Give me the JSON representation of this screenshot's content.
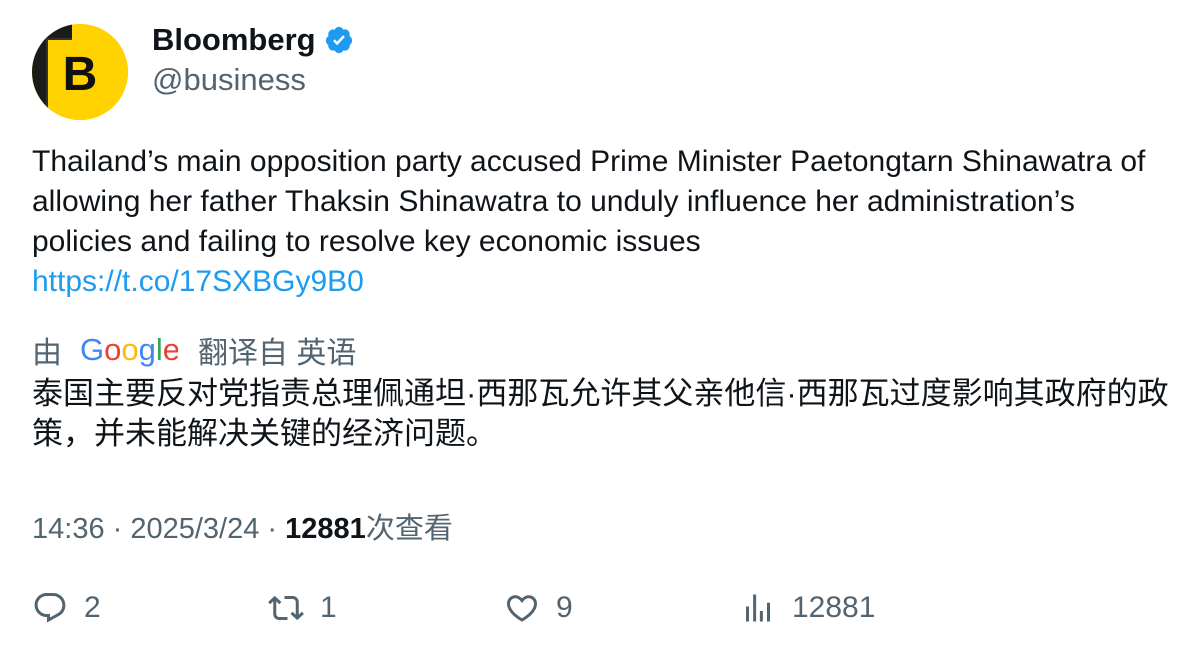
{
  "author": {
    "avatar_letter": "B",
    "name": "Bloomberg",
    "handle": "@business",
    "verified": true,
    "verified_color": "#1d9bf0",
    "avatar_color": "#ffd200"
  },
  "tweet": {
    "text": "Thailand’s main opposition party accused Prime Minister Paetongtarn Shinawatra of allowing her father Thaksin Shinawatra to unduly influence her administration’s policies and failing to resolve key economic issues",
    "link": "https://t.co/17SXBGy9B0"
  },
  "translation": {
    "prefix": "由",
    "provider": "Google",
    "suffix": "翻译自 英语",
    "text": "泰国主要反对党指责总理佩通坦·西那瓦允许其父亲他信·西那瓦过度影响其政府的政策，并未能解决关键的经济问题。"
  },
  "meta": {
    "time": "14:36",
    "separator": " · ",
    "date": "2025/3/24",
    "views": "12881",
    "views_label": "次查看"
  },
  "actions": {
    "replies": "2",
    "retweets": "1",
    "likes": "9",
    "views": "12881"
  },
  "icons": {
    "reply": "reply-icon",
    "retweet": "retweet-icon",
    "like": "heart-icon",
    "views": "bar-chart-icon"
  }
}
